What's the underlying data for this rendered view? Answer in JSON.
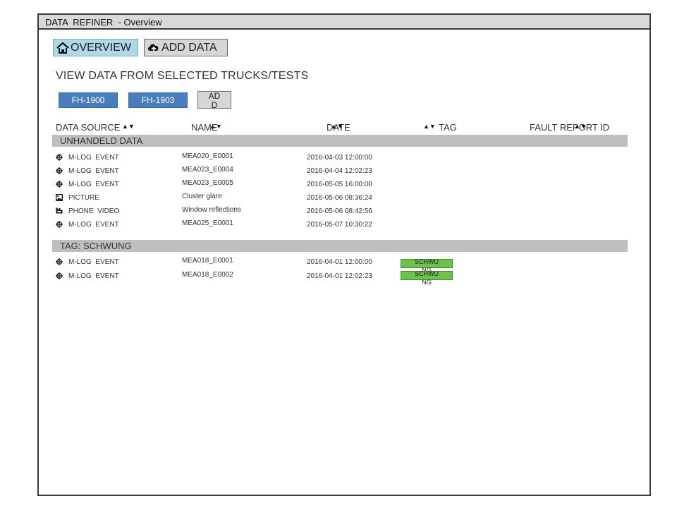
{
  "window": {
    "title": "DATA  REFINER  - Overview"
  },
  "nav": {
    "overview_label": "OVERVIEW",
    "add_data_label": "ADD DATA"
  },
  "heading": "VIEW DATA FROM SELECTED TRUCKS/TESTS",
  "trucks": [
    {
      "label": "FH-1900"
    },
    {
      "label": "FH-1903"
    }
  ],
  "add_truck_label": "ADD",
  "columns": {
    "data_source": "DATA  SOURCE",
    "name": "NAME",
    "date": "DATE",
    "tag": "TAG",
    "fault_report_id": "FAULT  REPORT  ID"
  },
  "sections": [
    {
      "title": "UNHANDELD  DATA",
      "rows": [
        {
          "icon": "crosshair-icon",
          "source": "M-LOG  EVENT",
          "name": "MEA020_E0001",
          "date": "2016-04-03 12:00:00",
          "tag": ""
        },
        {
          "icon": "crosshair-icon",
          "source": "M-LOG  EVENT",
          "name": "MEA023_E0004",
          "date": "2016-04-04 12:02:23",
          "tag": ""
        },
        {
          "icon": "crosshair-icon",
          "source": "M-LOG  EVENT",
          "name": "MEA023_E0005",
          "date": "2016-05-05 16:00:00",
          "tag": ""
        },
        {
          "icon": "picture-icon",
          "source": "PICTURE",
          "name": "Cluster glare",
          "date": "2016-05-06 08:36:24",
          "tag": ""
        },
        {
          "icon": "video-camera-icon",
          "source": "PHONE  VIDEO",
          "name": "Window reflections",
          "date": "2016-05-06 08:42:56",
          "tag": ""
        },
        {
          "icon": "crosshair-icon",
          "source": "M-LOG  EVENT",
          "name": "MEA025_E0001",
          "date": "2016-05-07 10:30:22",
          "tag": ""
        }
      ]
    },
    {
      "title": "TAG:  SCHWUNG",
      "rows": [
        {
          "icon": "crosshair-icon",
          "source": "M-LOG  EVENT",
          "name": "MEA018_E0001",
          "date": "2016-04-01 12:00:00",
          "tag": "SCHWUNG"
        },
        {
          "icon": "crosshair-icon",
          "source": "M-LOG  EVENT",
          "name": "MEA018_E0002",
          "date": "2016-04-01 12:02:23",
          "tag": "SCHWUNG"
        }
      ]
    }
  ],
  "colors": {
    "accent": "#4a7ebb",
    "active_nav": "#add8e6",
    "section_bg": "#bfbfbf",
    "tag_green": "#6cc24a"
  }
}
